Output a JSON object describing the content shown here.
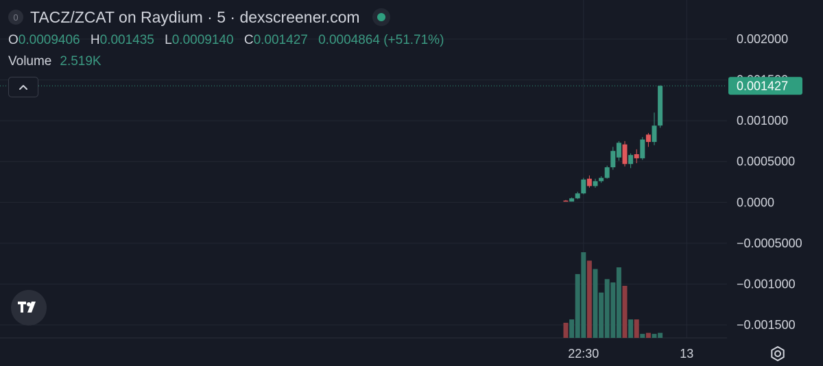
{
  "legend": {
    "badge": "0",
    "title": "TACZ/ZCAT on Raydium · 5 · dexscreener.com",
    "ohlc": {
      "o_label": "O",
      "o": "0.0009406",
      "h_label": "H",
      "h": "0.001435",
      "l_label": "L",
      "l": "0.0009140",
      "c_label": "C",
      "c": "0.001427",
      "change": "0.0004864 (+51.71%)"
    },
    "volume_label": "Volume",
    "volume_value": "2.519K"
  },
  "colors": {
    "background": "#161a25",
    "up": "#3b9a82",
    "down": "#e0585b",
    "up_volume": "#2f6f63",
    "down_volume": "#8e3d42",
    "grid": "#232834",
    "price_tag": "#2f9e7f"
  },
  "icons": {
    "collapse": "chevron-up-icon",
    "logo": "tradingview-logo-icon",
    "settings": "gear-icon"
  },
  "chart_data": {
    "type": "candlestick",
    "title": "TACZ/ZCAT on Raydium · 5 · dexscreener.com",
    "y_ticks": [
      {
        "value": 0.002,
        "label": "0.002000"
      },
      {
        "value": 0.0015,
        "label": "0.001500"
      },
      {
        "value": 0.001,
        "label": "0.001000"
      },
      {
        "value": 0.0005,
        "label": "0.0005000"
      },
      {
        "value": 0,
        "label": "0.0000"
      },
      {
        "value": -0.0005,
        "label": "−0.0005000"
      },
      {
        "value": -0.001,
        "label": "−0.001000"
      },
      {
        "value": -0.0015,
        "label": "−0.001500"
      }
    ],
    "ylim": [
      -0.00165,
      0.0021
    ],
    "x_ticks": [
      {
        "index": 3,
        "label": "22:30"
      },
      {
        "index": 20.5,
        "label": "13"
      }
    ],
    "last_price": {
      "value": 0.001427,
      "label": "0.001427"
    },
    "candles": [
      {
        "o": 2.2e-05,
        "h": 3e-05,
        "l": 1.4e-05,
        "c": 1e-05,
        "v": 0.45
      },
      {
        "o": 1e-05,
        "h": 6e-05,
        "l": 1e-05,
        "c": 5e-05,
        "v": 0.55
      },
      {
        "o": 5e-05,
        "h": 0.00013,
        "l": 4e-05,
        "c": 0.00011,
        "v": 1.9
      },
      {
        "o": 0.00011,
        "h": 0.0003,
        "l": 0.0001,
        "c": 0.00028,
        "v": 2.55
      },
      {
        "o": 0.00029,
        "h": 0.00033,
        "l": 0.00018,
        "c": 0.0002,
        "v": 2.3
      },
      {
        "o": 0.0002,
        "h": 0.00029,
        "l": 0.00018,
        "c": 0.00026,
        "v": 2.05
      },
      {
        "o": 0.00026,
        "h": 0.00032,
        "l": 0.00024,
        "c": 0.0003,
        "v": 1.35
      },
      {
        "o": 0.0003,
        "h": 0.00045,
        "l": 0.00029,
        "c": 0.00043,
        "v": 1.75
      },
      {
        "o": 0.00043,
        "h": 0.00068,
        "l": 0.0004,
        "c": 0.00063,
        "v": 1.65
      },
      {
        "o": 0.00055,
        "h": 0.00075,
        "l": 0.00051,
        "c": 0.00073,
        "v": 2.1
      },
      {
        "o": 0.00071,
        "h": 0.00075,
        "l": 0.00044,
        "c": 0.00047,
        "v": 1.55
      },
      {
        "o": 0.00047,
        "h": 0.0006,
        "l": 0.00042,
        "c": 0.00058,
        "v": 0.55
      },
      {
        "o": 0.00059,
        "h": 0.00065,
        "l": 0.00048,
        "c": 0.00054,
        "v": 0.55
      },
      {
        "o": 0.00054,
        "h": 0.0008,
        "l": 0.00052,
        "c": 0.00077,
        "v": 0.12
      },
      {
        "o": 0.00083,
        "h": 0.00085,
        "l": 0.00068,
        "c": 0.00074,
        "v": 0.15
      },
      {
        "o": 0.00074,
        "h": 0.0011,
        "l": 0.0007,
        "c": 0.00094,
        "v": 0.12
      },
      {
        "o": 0.000941,
        "h": 0.001435,
        "l": 0.000914,
        "c": 0.001427,
        "v": 0.15
      }
    ]
  }
}
